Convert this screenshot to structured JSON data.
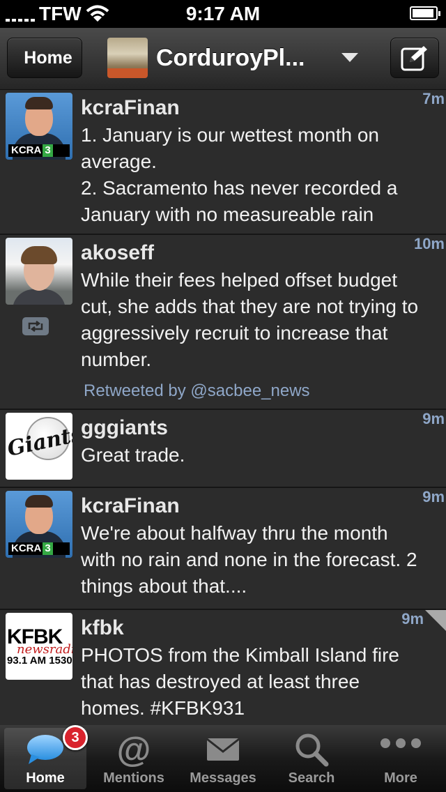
{
  "status_bar": {
    "carrier": "TFW",
    "time": "9:17 AM"
  },
  "nav": {
    "back_label": "Home",
    "account_title": "CorduroyPl..."
  },
  "tweets": [
    {
      "user": "kcraFinan",
      "time": "7m",
      "text": "1. January is our wettest month on average.\n2. Sacramento has never recorded a January with no measureable rain",
      "avatar_icon": "kcra-avatar"
    },
    {
      "user": "akoseff",
      "time": "10m",
      "text": "While their fees helped offset budget cut, she adds that they are not trying to aggressively recruit to increase that number.",
      "retweeted_by": "Retweeted by @sacbee_news",
      "avatar_icon": "person-avatar"
    },
    {
      "user": "gggiants",
      "time": "9m",
      "text": "Great trade.",
      "avatar_icon": "giants-logo"
    },
    {
      "user": "kcraFinan",
      "time": "9m",
      "text": "We're about halfway thru the month with no rain and none in the forecast. 2 things about that....",
      "avatar_icon": "kcra-avatar"
    },
    {
      "user": "kfbk",
      "time": "9m",
      "text": "PHOTOS from the Kimball Island fire that has destroyed at least three homes. #KFBK931",
      "avatar_icon": "kfbk-logo"
    }
  ],
  "avatar_text": {
    "kcra": "KCRA",
    "kcra_num": "3",
    "giants": "Giants",
    "kfbk": "KFBK",
    "kfbk_sub": "newsradio",
    "kfbk_freq": "93.1 AM 1530"
  },
  "tabs": [
    {
      "label": "Home",
      "icon": "speech-bubble-icon",
      "active": true,
      "badge": "3"
    },
    {
      "label": "Mentions",
      "icon": "at-sign-icon"
    },
    {
      "label": "Messages",
      "icon": "envelope-icon"
    },
    {
      "label": "Search",
      "icon": "magnifier-icon"
    },
    {
      "label": "More",
      "icon": "more-dots-icon"
    }
  ],
  "colors": {
    "link_blue": "#8fa7c8",
    "badge_red": "#d9232d",
    "background": "#2c2c2c"
  }
}
